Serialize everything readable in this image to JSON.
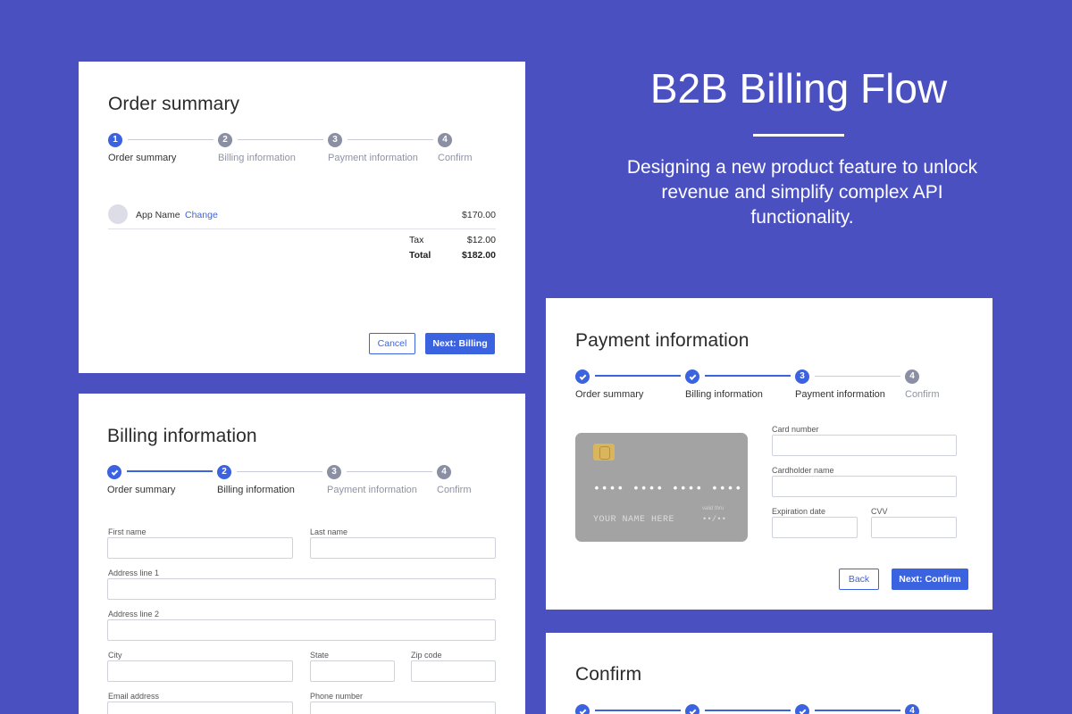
{
  "hero": {
    "title": "B2B Billing Flow",
    "subtitle": "Designing a new product feature to unlock revenue and simplify complex API functionality."
  },
  "steps": [
    "Order summary",
    "Billing information",
    "Payment information",
    "Confirm"
  ],
  "order_card": {
    "title": "Order summary",
    "current_step": 1,
    "app_name": "App Name",
    "change_link": "Change",
    "app_price": "$170.00",
    "tax_label": "Tax",
    "tax_value": "$12.00",
    "total_label": "Total",
    "total_value": "$182.00",
    "cancel_label": "Cancel",
    "next_label": "Next: Billing"
  },
  "billing_card": {
    "title": "Billing information",
    "current_step": 2,
    "fields": {
      "first_name": "First name",
      "last_name": "Last name",
      "address1": "Address line 1",
      "address2": "Address line 2",
      "city": "City",
      "state": "State",
      "zip": "Zip code",
      "email": "Email address",
      "phone": "Phone number"
    }
  },
  "payment_card": {
    "title": "Payment information",
    "current_step": 3,
    "card_preview": {
      "number": "•••• •••• •••• ••••",
      "name": "YOUR NAME HERE",
      "valid_label": "valid thru",
      "valid_value": "••/••"
    },
    "fields": {
      "card_number": "Card number",
      "cardholder": "Cardholder name",
      "expiration": "Expiration date",
      "cvv": "CVV"
    },
    "back_label": "Back",
    "next_label": "Next: Confirm"
  },
  "confirm_card": {
    "title": "Confirm",
    "current_step": 4
  },
  "colors": {
    "background": "#4b50c0",
    "accent": "#3b63e0",
    "inactive": "#8a8fa3"
  }
}
